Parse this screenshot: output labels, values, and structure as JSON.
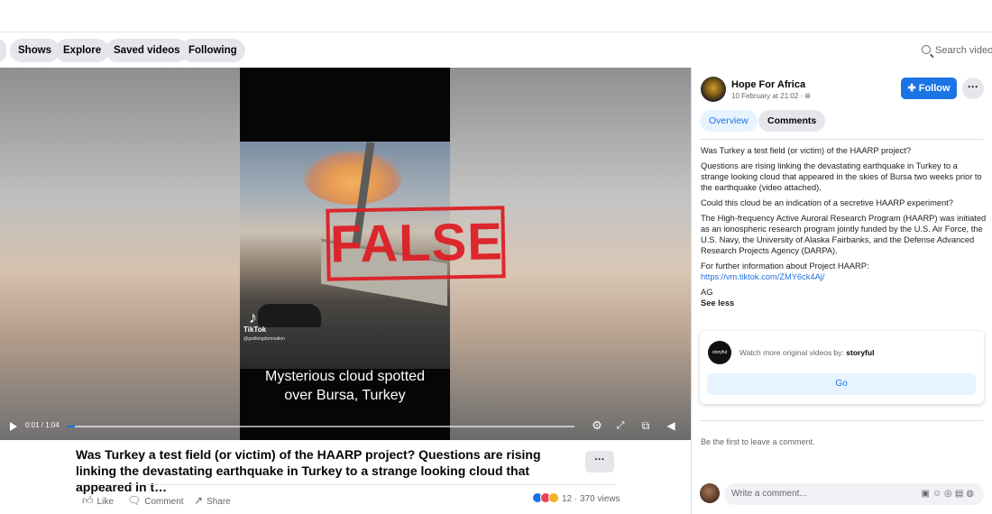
{
  "nav": {
    "pills": [
      "Shows",
      "Explore",
      "Saved videos",
      "Following"
    ],
    "search_placeholder": "Search videos"
  },
  "video": {
    "caption_line1": "Mysterious cloud spotted",
    "caption_line2": "over Bursa, Turkey",
    "stamp": "FALSE",
    "tiktok_brand": "TikTok",
    "tiktok_handle": "@godkingdomnation",
    "time": "0:01 / 1:04",
    "progress": 0.016
  },
  "post_title": "Was Turkey a test field (or victim) of the HAARP project? Questions are rising linking the devastating earthquake in Turkey to a strange looking cloud that appeared in t…",
  "actions": {
    "like": "Like",
    "comment": "Comment",
    "share": "Share",
    "stats": "12 · 370 views"
  },
  "panel": {
    "page_name": "Hope For Africa",
    "date": "10 February at 21:02 · ",
    "follow_label": "Follow",
    "tabs": [
      "Overview",
      "Comments"
    ],
    "paragraphs": [
      "Was Turkey a test field (or victim) of the HAARP project?",
      "Questions are rising linking the devastating earthquake in Turkey to a strange looking cloud that appeared in the skies of Bursa two weeks prior to the earthquake (video attached).",
      "Could this cloud be an indication of a secretive HAARP experiment?",
      "The High-frequency Active Auroral Research Program (HAARP) was initiated as an ionospheric research program jointly funded by the U.S. Air Force, the U.S. Navy, the University of Alaska Fairbanks, and the Defense Advanced Research Projects Agency (DARPA)."
    ],
    "further_info": "For further information about Project HAARP:",
    "link": "https://vm.tiktok.com/ZMY6ck4Aj/",
    "signoff": "AG",
    "see_less": "See less",
    "card_prefix": "Watch more original videos by: ",
    "card_brand": "storyful",
    "go_label": "Go",
    "first_comment": "Be the first to leave a comment.",
    "comment_placeholder": "Write a comment..."
  },
  "colors": {
    "accent": "#1b74e4",
    "stamp": "#dd1f26"
  }
}
